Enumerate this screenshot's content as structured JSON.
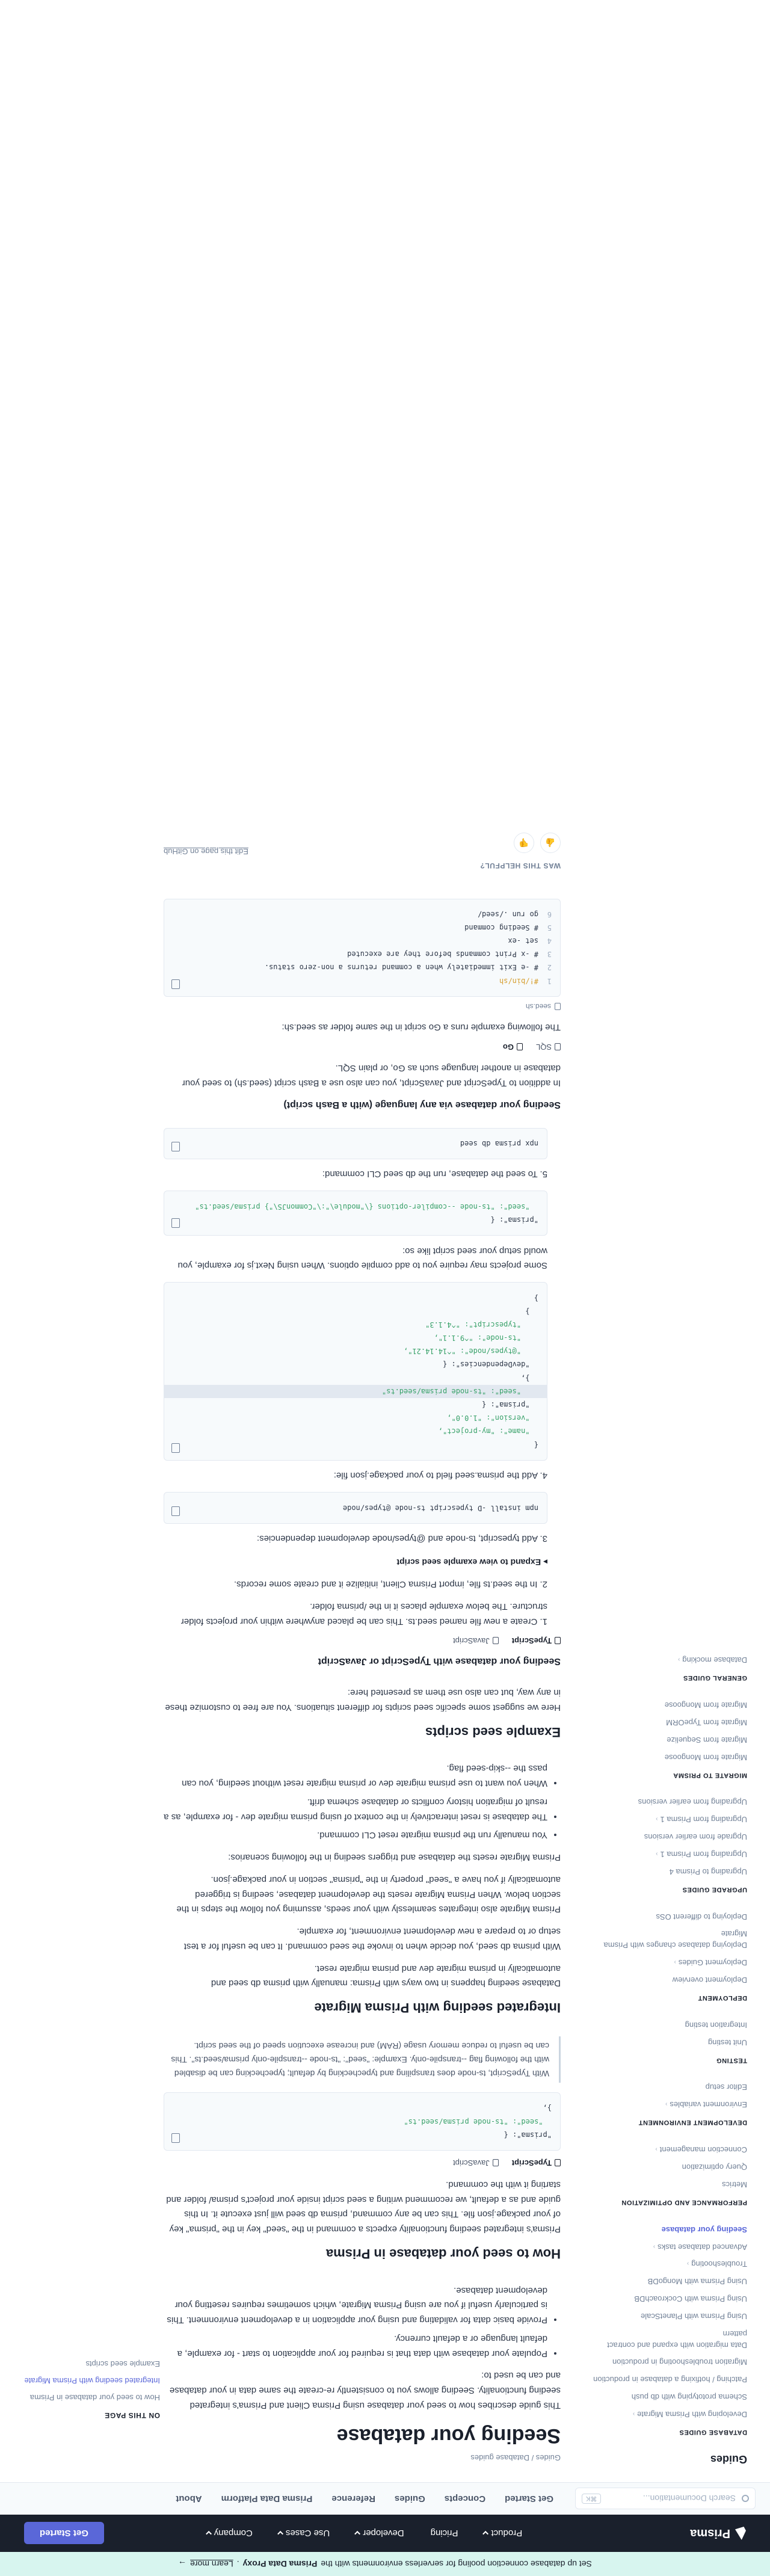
{
  "banner": {
    "text": "Set up database connection pooling for serverless environments with the",
    "bold": "Prisma Data Proxy",
    "link": "Learn more",
    "arrow": "→"
  },
  "topnav": {
    "logo": "Prisma",
    "links": [
      "Product",
      "Pricing",
      "Developer",
      "Use Cases",
      "Company"
    ],
    "cta": "Get Started"
  },
  "subnav": {
    "search_placeholder": "Search Documentation...",
    "shortcut": "⌘K",
    "links": [
      "Get Started",
      "Concepts",
      "Guides",
      "Reference",
      "Prisma Data Platform",
      "About"
    ]
  },
  "sidebar": {
    "title": "Guides",
    "sections": [
      {
        "heading": "Database guides",
        "items": [
          {
            "label": "Developing with Prisma Migrate",
            "expandable": true
          },
          {
            "label": "Schema prototyping with db push",
            "expandable": false
          },
          {
            "label": "Patching / hotfixing a database in production",
            "expandable": false
          },
          {
            "label": "Migration troubleshooting in production",
            "expandable": false
          },
          {
            "label": "Data migration with expand and contract pattern",
            "expandable": false
          },
          {
            "label": "Using Prisma with PlanetScale",
            "expandable": false
          },
          {
            "label": "Using Prisma with CockroachDB",
            "expandable": false
          },
          {
            "label": "Using Prisma with MongoDB",
            "expandable": false
          },
          {
            "label": "Troubleshooting",
            "expandable": true
          },
          {
            "label": "Advanced database tasks",
            "expandable": true
          },
          {
            "label": "Seeding your database",
            "expandable": false,
            "active": true
          }
        ]
      },
      {
        "heading": "Performance and optimization",
        "items": [
          {
            "label": "Metrics",
            "expandable": false
          },
          {
            "label": "Query optimization",
            "expandable": false
          },
          {
            "label": "Connection management",
            "expandable": true
          }
        ]
      },
      {
        "heading": "Development environment",
        "items": [
          {
            "label": "Environment variables",
            "expandable": true
          },
          {
            "label": "Editor setup",
            "expandable": false
          }
        ]
      },
      {
        "heading": "Testing",
        "items": [
          {
            "label": "Unit testing",
            "expandable": false
          },
          {
            "label": "Integration testing",
            "expandable": false
          }
        ]
      },
      {
        "heading": "Deployment",
        "items": [
          {
            "label": "Deployment overview",
            "expandable": false
          },
          {
            "label": "Deployment Guides",
            "expandable": true
          },
          {
            "label": "Deploying database changes with Prisma Migrate",
            "expandable": false
          },
          {
            "label": "Deploying to different OSs",
            "expandable": false
          }
        ]
      },
      {
        "heading": "Upgrade guides",
        "items": [
          {
            "label": "Upgrading to Prisma 4",
            "expandable": false
          },
          {
            "label": "Upgrading from Prisma 1",
            "expandable": true
          },
          {
            "label": "Upgrade from earlier versions",
            "expandable": false
          },
          {
            "label": "Upgrading from Prisma 1",
            "expandable": true
          },
          {
            "label": "Upgrading from earlier versions",
            "expandable": false
          }
        ]
      },
      {
        "heading": "Migrate to Prisma",
        "items": [
          {
            "label": "Migrate from Mongoose",
            "expandable": false
          },
          {
            "label": "Migrate from Sequelize",
            "expandable": false
          },
          {
            "label": "Migrate from TypeORM",
            "expandable": false
          },
          {
            "label": "Migrate from Mongoose",
            "expandable": false
          }
        ]
      },
      {
        "heading": "General guides",
        "items": [
          {
            "label": "Database mocking",
            "expandable": true
          }
        ]
      }
    ]
  },
  "main": {
    "breadcrumb": "Guides / Database guides",
    "title": "Seeding your database",
    "intro": "This guide describes how to seed your database using Prisma Client and Prisma's integrated seeding functionality. Seeding allows you to consistently re-create the same data in your database and can be used to:",
    "intro_bullets": [
      "Populate your database with data that is required for your application to start - for example, a default language or a default currency.",
      "Provide basic data for validating and using your application in a development environment. This is particularly useful if you are using Prisma Migrate, which sometimes requires resetting your development database."
    ],
    "h_how": "How to seed your database in Prisma",
    "how_p": "Prisma's integrated seeding functionality expects a command in the \"seed\" key in the \"prisma\" key of your package.json file. This can be any command, prisma db seed will just execute it. In this guide and as a default, we recommend writing a seed script inside your project's prisma/ folder and starting it with the command.",
    "tabs1": [
      "TypeScript",
      "JavaScript"
    ],
    "code_how": [
      "\"prisma\": {",
      "  \"seed\": \"ts-node prisma/seed.ts\"",
      "},"
    ],
    "note_how": "With TypeScript, ts-node does transpiling and typechecking by default; typechecking can be disabled with the following flag --transpile-only. Example: \"seed\": \"ts-node --transpile-only prisma/seed.ts\". This can be useful to reduce memory usage (RAM) and increase execution speed of the seed script.",
    "h_integrated": "Integrated seeding with Prisma Migrate",
    "integrated_p1": "Database seeding happens in two ways with Prisma: manually with prisma db seed and automatically in prisma migrate dev and prisma migrate reset.",
    "integrated_p2": "With prisma db seed, you decide when to invoke the seed command. It can be useful for a test setup or to prepare a new development environment, for example.",
    "integrated_p3": "Prisma Migrate also integrates seamlessly with your seeds, assuming you follow the steps in the section below. When Prisma Migrate resets the development database, seeding is triggered automatically if you have a \"seed\" property in the \"prisma\" section in your package.json.",
    "integrated_p4": "Prisma Migrate resets the database and triggers seeding in the following scenarios:",
    "integrated_bullets": [
      "You manually run the prisma migrate reset CLI command.",
      "The database is reset interactively in the context of using prisma migrate dev - for example, as a result of migration history conflicts or database schema drift.",
      "When you want to use prisma migrate dev or prisma migrate reset without seeding, you can pass the --skip-seed flag."
    ],
    "h_examples": "Example seed scripts",
    "examples_p": "Here we suggest some specific seed scripts for different situations. You are free to customize these in any way, but can also use them as presented here:",
    "h_ts": "Seeding your database with TypeScript or JavaScript",
    "tabs2": [
      "TypeScript",
      "JavaScript"
    ],
    "step1": "1. Create a new file named seed.ts. This can be placed anywhere within your projects folder structure. The below example places it in the /prisma folder.",
    "step2": "2. In the seed.ts file, import Prisma Client, initialize it and create some records.",
    "expand": "Expand to view example seed script",
    "step3": "3. Add typescript, ts-node and @types/node development dependencies:",
    "code_install": "npm install -D typescript ts-node @types/node",
    "step4": "4. Add the prisma.seed field to your package.json file:",
    "code_pkg": [
      "{",
      "  \"name\": \"my-project\",",
      "  \"version\": \"1.0.0\",",
      "  \"prisma\": {",
      "    \"seed\": \"ts-node prisma/seed.ts\"",
      "  },",
      "  \"devDependencies\": {",
      "    \"@types/node\": \"^14.14.21\",",
      "    \"ts-node\": \"^9.1.1\",",
      "    \"typescript\": \"^4.1.3\"",
      "  }",
      "}"
    ],
    "step4_p": "Some projects may require you to add compile options. When using Next.js for example, you would setup your seed script like so:",
    "code_next": [
      "\"prisma\": {",
      "  \"seed\": \"ts-node --compiler-options {\\\"module\\\":\\\"CommonJS\\\"} prisma/seed.ts\""
    ],
    "step5": "5. To seed the database, run the db seed CLI command:",
    "code_seed": "npx prisma db seed",
    "h_bash": "Seeding your database via any language (with a Bash script)",
    "bash_p": "In addition to TypeScript and JavaScript, you can also use a Bash script (seed.sh) to seed your database in another language such as Go, or plain SQL.",
    "tabs3": [
      "SQL",
      "Go"
    ],
    "bash_p2": "The following example runs a Go script in the same folder as seed.sh:",
    "file_label": "seed.sh",
    "code_bash": [
      "#!/bin/sh",
      "# -e Exit immediately when a command returns a non-zero status.",
      "# -x Print commands before they are executed",
      "set -ex",
      "# Seeding command",
      "go run ./seed/"
    ],
    "helpful": "WAS THIS HELPFUL?",
    "thumb_up": "👍",
    "thumb_down": "👎",
    "edit": "Edit this page on GitHub"
  },
  "toc": {
    "title": "ON THIS PAGE",
    "items": [
      "Example seed scripts",
      "Integrated seeding with Prisma Migrate",
      "How to seed your database in Prisma"
    ]
  }
}
